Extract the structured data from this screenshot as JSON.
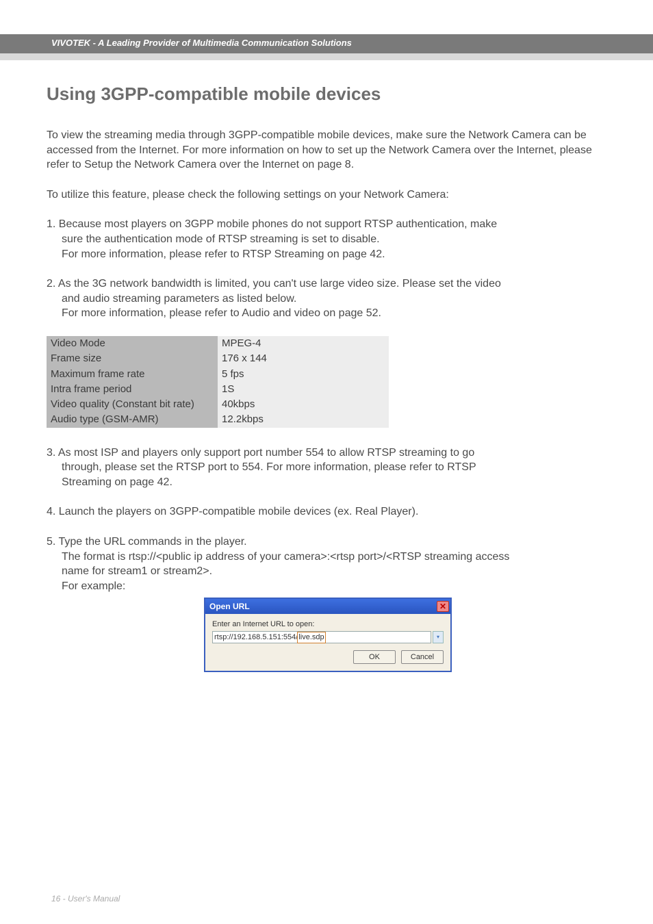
{
  "header": {
    "brand_line": "VIVOTEK - A Leading Provider of Multimedia Communication Solutions"
  },
  "title": "Using 3GPP-compatible mobile devices",
  "para1": "To view the streaming media through 3GPP-compatible mobile devices, make sure the Network Camera can be accessed from the Internet. For more information on how to set up the Network Camera over the Internet, please refer to Setup the Network Camera over the Internet on page 8.",
  "para2": "To utilize this feature, please check the following settings on your Network Camera:",
  "item1_line1": "1. Because most players on 3GPP mobile phones do not support RTSP authentication, make",
  "item1_line2": "sure the authentication mode of RTSP streaming is set to disable.",
  "item1_line3": "For more information, please refer to RTSP Streaming on page 42.",
  "item2_line1": "2. As the 3G network bandwidth is limited, you can't use large video size. Please set the video",
  "item2_line2": "and audio streaming parameters as listed below.",
  "item2_line3": "For more information, please refer to Audio and video on page 52.",
  "settings": [
    {
      "label": "Video Mode",
      "value": "MPEG-4"
    },
    {
      "label": "Frame size",
      "value": "176 x 144"
    },
    {
      "label": "Maximum frame rate",
      "value": "5 fps"
    },
    {
      "label": "Intra frame period",
      "value": "1S"
    },
    {
      "label": "Video quality (Constant bit rate)",
      "value": "40kbps"
    },
    {
      "label": "Audio type (GSM-AMR)",
      "value": "12.2kbps"
    }
  ],
  "item3_line1": "3. As most ISP and players only support port number 554 to allow RTSP streaming to go",
  "item3_line2": "through, please set the RTSP port to 554. For more information, please refer to RTSP",
  "item3_line3": "Streaming on page 42.",
  "item4": "4. Launch the players on 3GPP-compatible mobile devices (ex. Real Player).",
  "item5_line1": "5. Type the URL commands in the player.",
  "item5_line2": "The format is rtsp://<public ip address of your camera>:<rtsp port>/<RTSP streaming access",
  "item5_line3": "name for stream1 or stream2>.",
  "item5_line4": "For example:",
  "dialog": {
    "title": "Open URL",
    "label": "Enter an Internet URL to open:",
    "url_prefix": "rtsp://192.168.5.151:554/",
    "url_suffix": "live.sdp",
    "ok": "OK",
    "cancel": "Cancel"
  },
  "footer": "16 - User's Manual"
}
